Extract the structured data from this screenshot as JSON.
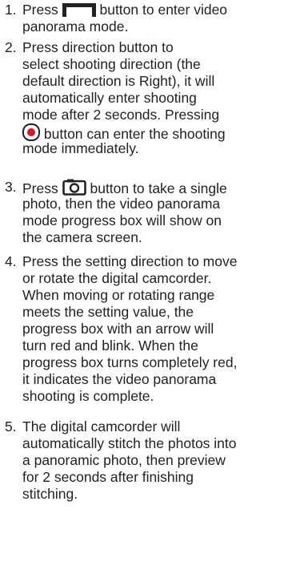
{
  "steps": [
    {
      "number": "1.",
      "lines": [
        "Press",
        "button to enter video",
        "panorama mode."
      ],
      "icon": "panorama-mode-icon"
    },
    {
      "number": "2.",
      "lines": [
        "Press direction button to",
        "select shooting direction (the",
        "default direction is Right), it will",
        "automatically enter shooting",
        "mode after 2 seconds. Pressing",
        "button can enter the shooting",
        "mode immediately."
      ],
      "icon": "record-button-icon"
    },
    {
      "number": "3.",
      "lines": [
        "Press",
        "button to take a single",
        "photo, then the video panorama",
        "mode progress box will show on",
        "the camera screen."
      ],
      "icon": "camera-icon"
    },
    {
      "number": "4.",
      "lines": [
        "Press the setting direction to move",
        "or rotate the digital camcorder.",
        "When moving or rotating range",
        "meets the setting value, the",
        "progress box with an arrow will",
        "turn red and blink. When the",
        "progress box turns completely red,",
        "it indicates the video panorama",
        "shooting is complete."
      ]
    },
    {
      "number": "5.",
      "lines": [
        "The digital camcorder will",
        "automatically stitch the photos into",
        "a panoramic photo, then preview",
        "for 2 seconds after finishing",
        "stitching."
      ]
    }
  ],
  "colors": {
    "text": "#222222",
    "record_red": "#d7182a"
  }
}
